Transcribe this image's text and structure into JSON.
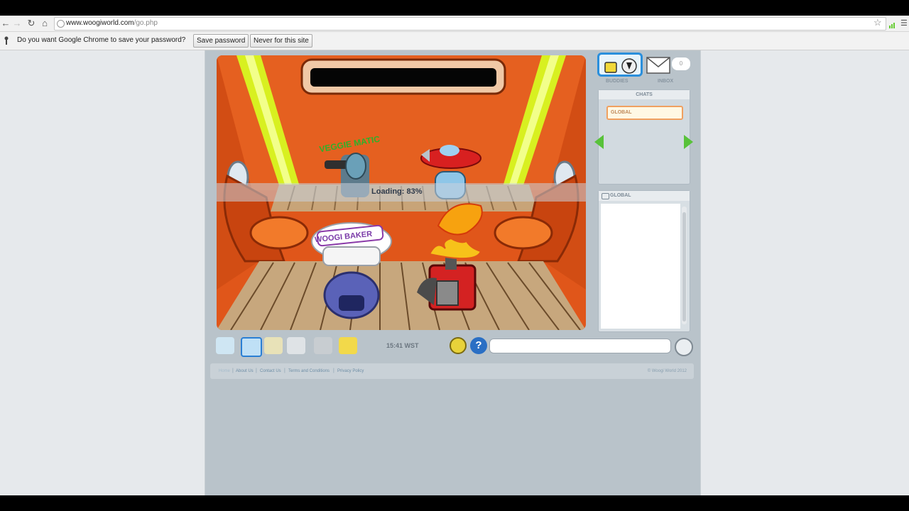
{
  "browser": {
    "url_domain": "www.woogiworld.com",
    "url_path": "/go.php",
    "infobar": {
      "question": "Do you want Google Chrome to save your password?",
      "save_label": "Save password",
      "never_label": "Never for this site"
    }
  },
  "game": {
    "loading_text": "Loading: 83%",
    "loading_progress": 0.83,
    "signs": {
      "veggie": "VEGGIE MATIC",
      "baker": "WOOGI BAKER"
    },
    "clock": "15:41 WST"
  },
  "side_panel": {
    "buddies_label": "BUDDIES",
    "inbox_label": "INBOX",
    "inbox_count": "0",
    "chats_header": "CHATS",
    "chat_tab": "GLOBAL",
    "global_header": "GLOBAL"
  },
  "footer": {
    "links": [
      "Home",
      "About Us",
      "Contact Us",
      "Terms and Conditions",
      "Privacy Policy"
    ],
    "copyright": "© Woogi World 2012"
  },
  "colors": {
    "room_orange": "#e0561a",
    "neon_yellow": "#d8f020",
    "floor_wood": "#c7a77d",
    "accent_blue": "#2a7fd4"
  }
}
